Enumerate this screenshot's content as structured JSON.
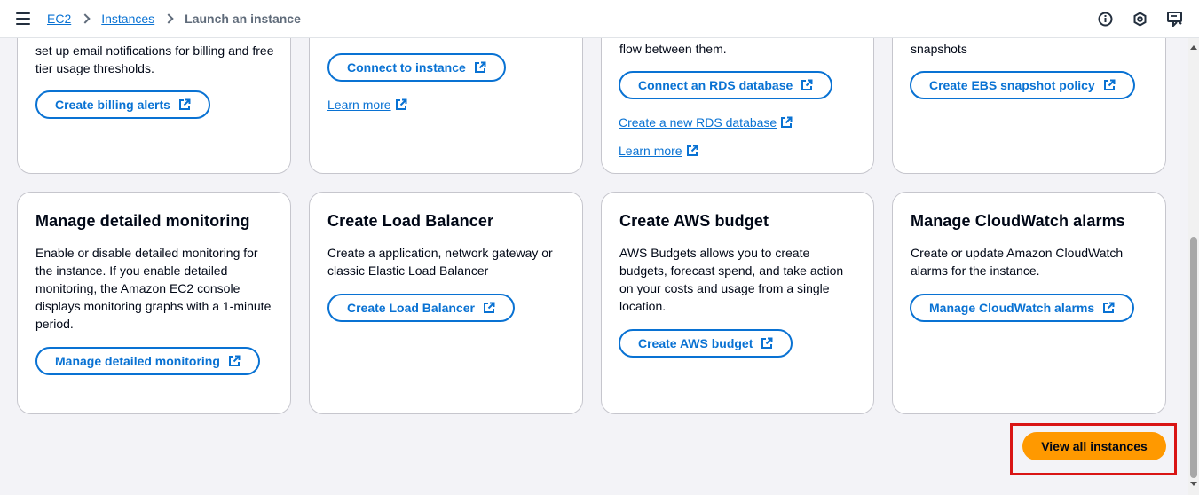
{
  "breadcrumb": {
    "items": [
      "EC2",
      "Instances"
    ],
    "current": "Launch an instance"
  },
  "top_icons": [
    "info-icon",
    "settings-hexagon-icon",
    "feedback-icon"
  ],
  "cards_row1": [
    {
      "desc": "set up email notifications for billing and free tier usage thresholds.",
      "button": "Create billing alerts"
    },
    {
      "button": "Connect to instance",
      "link": "Learn more"
    },
    {
      "desc": "flow between them.",
      "button": "Connect an RDS database",
      "link1": "Create a new RDS database",
      "link2": "Learn more"
    },
    {
      "desc": "snapshots",
      "button": "Create EBS snapshot policy"
    }
  ],
  "cards_row2": [
    {
      "title": "Manage detailed monitoring",
      "desc": "Enable or disable detailed monitoring for the instance. If you enable detailed monitoring, the Amazon EC2 console displays monitoring graphs with a 1-minute period.",
      "button": "Manage detailed monitoring"
    },
    {
      "title": "Create Load Balancer",
      "desc": "Create a application, network gateway or classic Elastic Load Balancer",
      "button": "Create Load Balancer"
    },
    {
      "title": "Create AWS budget",
      "desc": "AWS Budgets allows you to create budgets, forecast spend, and take action on your costs and usage from a single location.",
      "button": "Create AWS budget"
    },
    {
      "title": "Manage CloudWatch alarms",
      "desc": "Create or update Amazon CloudWatch alarms for the instance.",
      "button": "Manage CloudWatch alarms"
    }
  ],
  "primary_button": "View all instances",
  "colors": {
    "link": "#0972d3",
    "primary": "#ff9900",
    "highlight": "#d91515",
    "background": "#f3f3f7"
  }
}
